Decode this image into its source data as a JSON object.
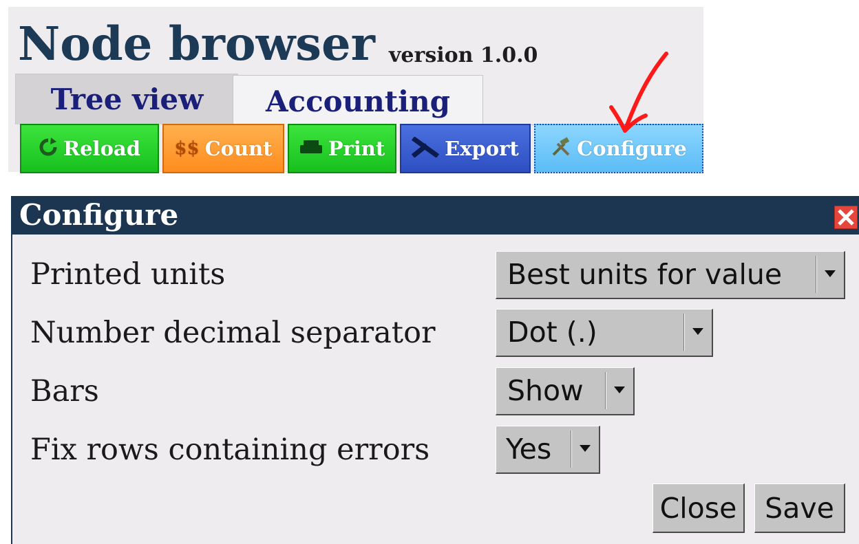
{
  "app": {
    "title": "Node browser",
    "version": "version 1.0.0"
  },
  "tabs": [
    {
      "label": "Tree view",
      "active": false
    },
    {
      "label": "Accounting",
      "active": true
    }
  ],
  "toolbar": {
    "reload": {
      "label": "Reload",
      "icon": "refresh-icon",
      "color": "#22cc22"
    },
    "count": {
      "label": "Count",
      "icon": "$$",
      "color": "#ff9a30"
    },
    "print": {
      "label": "Print",
      "icon": "printer-icon",
      "color": "#22cc22"
    },
    "export": {
      "label": "Export",
      "icon": "excel-icon",
      "color": "#3a5ed0"
    },
    "configure": {
      "label": "Configure",
      "icon": "tools-icon",
      "color": "#6cc8ff"
    }
  },
  "dialog": {
    "title": "Configure",
    "titlebar_color": "#1c3550",
    "rows": [
      {
        "label": "Printed units",
        "value": "Best units for value"
      },
      {
        "label": "Number decimal separator",
        "value": "Dot (.)"
      },
      {
        "label": "Bars",
        "value": "Show"
      },
      {
        "label": "Fix rows containing errors",
        "value": "Yes"
      }
    ],
    "buttons": {
      "close": "Close",
      "save": "Save"
    }
  },
  "annotation": {
    "color": "#ff1a1a"
  }
}
